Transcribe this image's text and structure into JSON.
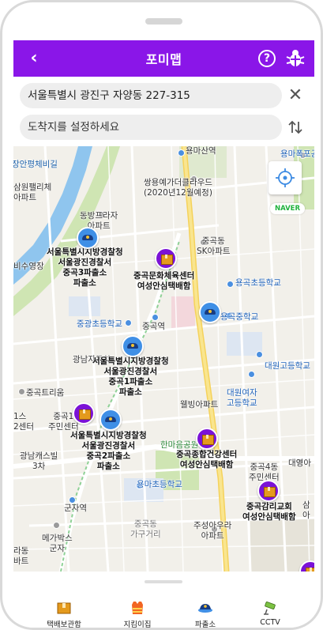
{
  "app": {
    "title": "포미맵"
  },
  "search": {
    "origin_value": "서울특별시 광진구 자양동 227-315",
    "destination_placeholder": "도착지를 설정하세요"
  },
  "map": {
    "naver_badge": "NAVER",
    "labels": {
      "yongma_station": "용마산역",
      "yongma_falls": "용마폭포공",
      "samsung_raemian": "삼성래미안아파트",
      "jangan": "장안평체비길",
      "ssangyong": "쌍용예가더클라우드\n(2020년12월예정)",
      "dongbang": "동방프라자\n아파트",
      "junggok_sk": "중곡동\nSK아파트",
      "police3": "서울특별시지방경찰청\n서울광진경찰서\n중곡3파출소\n파출소",
      "culture_center": "중곡문화체육센터\n여성안심택배함",
      "yonggok_elem": "용곡초등학교",
      "junggang_elem": "중광초등학교",
      "junggok_station": "중곡역",
      "yonggok_mid": "용곡중학교",
      "gwangnam": "광남자동차",
      "police1": "서울특별시지방경찰청\n서울광진경찰서\n중곡1파출소\n파출소",
      "daewon_high": "대원고등학교",
      "junggok_triume": "중곡트리움",
      "daewon_girls": "대원여자\n고등학교",
      "wellbing": "웰빙아파트",
      "junggok1_center": "중곡1\n주민센터",
      "police2": "서울특별시지방경찰청\n서울광진경찰서\n중곡2파출소\n파출소",
      "hanmaeum": "한마음공원",
      "health_center": "중곡종합건강센터\n여성안심택배함",
      "daeyeong": "대영아",
      "gwangnam_castle": "광남캐스빌\n3차",
      "junggok4_center": "중곡4동\n주민센터",
      "yongma_elem": "용마초등학교",
      "church": "중곡감리교회\n여성안심택배함",
      "gunja_station": "군자역",
      "junggok_street": "중곡동\n가구거리",
      "jusung": "주성아우라\n아파트",
      "megabox": "메가박스\n군자",
      "left_edge1": "삼원팰리체\n아파트",
      "left_edge2": "비수영장",
      "left_edge3": "1스\n2센터",
      "left_edge4": "라동\n바트",
      "right_edge": "삼\n아"
    }
  },
  "tabs": [
    {
      "label": "택배보관함"
    },
    {
      "label": "지킴이집"
    },
    {
      "label": "파출소"
    },
    {
      "label": "CCTV"
    }
  ]
}
